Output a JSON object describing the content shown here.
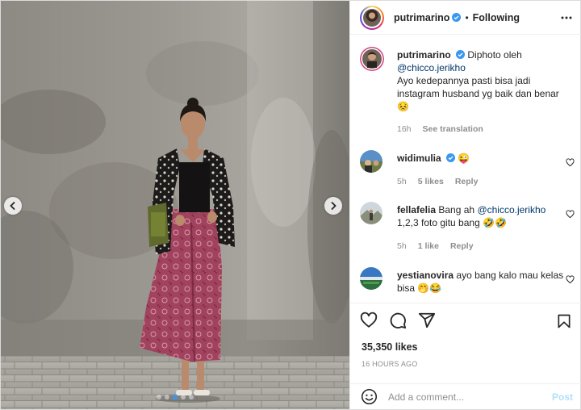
{
  "post": {
    "author": {
      "username": "putrimarino",
      "follow_status": "Following",
      "separator": "•"
    },
    "caption": {
      "username": "putrimarino",
      "text_before_mention": "Diphoto oleh",
      "mention": "@chicco.jerikho",
      "text_after_mention": "Ayo kedepannya pasti bisa jadi instagram husband yg baik dan benar",
      "emoji": "😣",
      "time": "16h",
      "see_translation": "See translation"
    },
    "comments": [
      {
        "username": "widimulia",
        "verified": true,
        "text": "😜",
        "time": "5h",
        "likes": "5 likes",
        "reply": "Reply"
      },
      {
        "username": "fellafelia",
        "verified": false,
        "text_before_mention": "Bang ah",
        "mention": "@chicco.jerikho",
        "text_after_mention": "1,2,3 foto gitu bang 🤣🤣",
        "time": "5h",
        "likes": "1 like",
        "reply": "Reply"
      },
      {
        "username": "yestianovira",
        "verified": false,
        "text": "ayo bang kalo mau kelas bisa 🤭😂"
      }
    ],
    "likes_count": "35,350 likes",
    "time_ago": "16 HOURS AGO",
    "add_comment": {
      "placeholder": "Add a comment...",
      "post_label": "Post"
    },
    "carousel": {
      "total": 5,
      "active_index": 2
    },
    "icons": {
      "prev": "chevron-left-icon",
      "next": "chevron-right-icon",
      "more": "more-dots-icon",
      "like": "heart-icon",
      "comment": "comment-icon",
      "share": "send-icon",
      "save": "bookmark-icon",
      "emoji": "emoji-icon",
      "comment_like": "heart-outline-icon",
      "verified": "verified-badge-icon"
    },
    "colors": {
      "verified_blue": "#3897f0",
      "mention": "#00376b",
      "muted": "#8e8e8e",
      "post_disabled": "#b2dffc"
    }
  }
}
